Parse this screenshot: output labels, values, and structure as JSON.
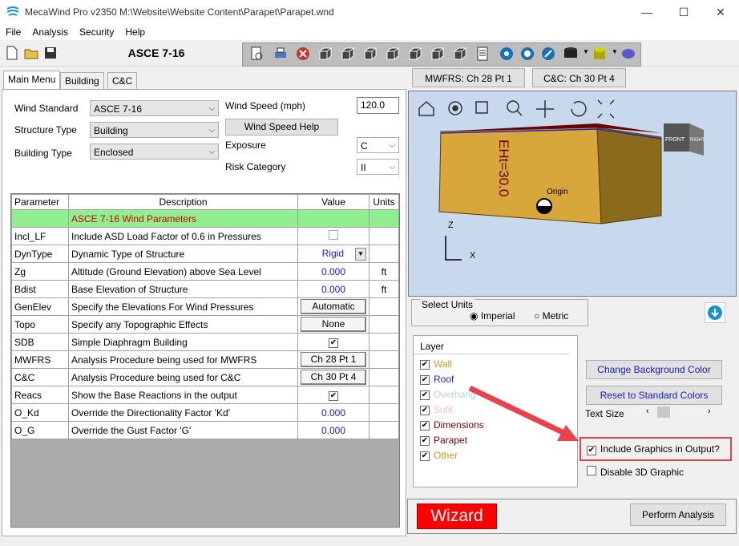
{
  "window": {
    "title": "MecaWind Pro v2350 M:\\Website\\Website Content\\Parapet\\Parapet.wnd",
    "minimize": "—",
    "maximize": "☐",
    "close": "✕"
  },
  "menu": [
    "File",
    "Analysis",
    "Security",
    "Help"
  ],
  "toolbar": {
    "standard_title": "ASCE 7-16"
  },
  "tabs": [
    "Main Menu",
    "Building",
    "C&C"
  ],
  "main": {
    "wind_standard_label": "Wind Standard",
    "wind_standard_value": "ASCE 7-16",
    "structure_type_label": "Structure Type",
    "structure_type_value": "Building",
    "building_type_label": "Building Type",
    "building_type_value": "Enclosed",
    "wind_speed_label": "Wind Speed (mph)",
    "wind_speed_value": "120.0",
    "wind_speed_help": "Wind Speed Help",
    "exposure_label": "Exposure",
    "exposure_value": "C",
    "risk_label": "Risk Category",
    "risk_value": "II"
  },
  "grid": {
    "headers": [
      "Parameter",
      "Description",
      "Value",
      "Units"
    ],
    "section": "ASCE 7-16 Wind Parameters",
    "rows": [
      {
        "p": "Incl_LF",
        "d": "Include ASD Load Factor of 0.6 in Pressures",
        "v": "",
        "u": ""
      },
      {
        "p": "DynType",
        "d": "Dynamic Type of Structure",
        "v": "Rigid",
        "u": ""
      },
      {
        "p": "Zg",
        "d": "Altitude (Ground Elevation) above Sea Level",
        "v": "0.000",
        "u": "ft"
      },
      {
        "p": "Bdist",
        "d": "Base Elevation of Structure",
        "v": "0.000",
        "u": "ft"
      },
      {
        "p": "GenElev",
        "d": "Specify the Elevations For Wind Pressures",
        "v": "Automatic",
        "u": ""
      },
      {
        "p": "Topo",
        "d": "Specify any Topographic Effects",
        "v": "None",
        "u": ""
      },
      {
        "p": "SDB",
        "d": "Simple Diaphragm Building",
        "v": "✔",
        "u": ""
      },
      {
        "p": "MWFRS",
        "d": "Analysis Procedure being used for MWFRS",
        "v": "Ch 28 Pt 1",
        "u": ""
      },
      {
        "p": "C&C",
        "d": "Analysis Procedure being used for C&C",
        "v": "Ch 30 Pt 4",
        "u": ""
      },
      {
        "p": "Reacs",
        "d": "Show the Base Reactions in the output",
        "v": "✔",
        "u": ""
      },
      {
        "p": "O_Kd",
        "d": "Override the Directionality Factor 'Kd'",
        "v": "0.000",
        "u": ""
      },
      {
        "p": "O_G",
        "d": "Override the Gust Factor 'G'",
        "v": "0.000",
        "u": ""
      }
    ]
  },
  "right": {
    "mwfrs_btn": "MWFRS: Ch 28 Pt 1",
    "cc_btn": "C&C: Ch 30 Pt 4",
    "viewport": {
      "eht_label": "EHt=30.0",
      "origin_label": "Origin",
      "z_axis": "Z",
      "x_axis": "X",
      "cube_front": "FRONT",
      "cube_right": "RIGHT"
    },
    "units_title": "Select Units",
    "imperial": "Imperial",
    "metric": "Metric",
    "layer_header": "Layer",
    "layers": [
      {
        "name": "Wall",
        "color": "#c79a2e"
      },
      {
        "name": "Roof",
        "color": "#2222cc"
      },
      {
        "name": "Overhang",
        "color": "#b9d1e6"
      },
      {
        "name": "Sofit",
        "color": "#f4c2c2"
      },
      {
        "name": "Dimensions",
        "color": "#800000"
      },
      {
        "name": "Parapet",
        "color": "#800000"
      },
      {
        "name": "Other",
        "color": "#c79a2e"
      }
    ],
    "change_bg": "Change Background Color",
    "reset_colors": "Reset to Standard Colors",
    "text_size": "Text Size",
    "include_graphics": "Include Graphics in Output?",
    "disable_3d": "Disable 3D Graphic",
    "wizard": "Wizard",
    "perform": "Perform Analysis"
  }
}
